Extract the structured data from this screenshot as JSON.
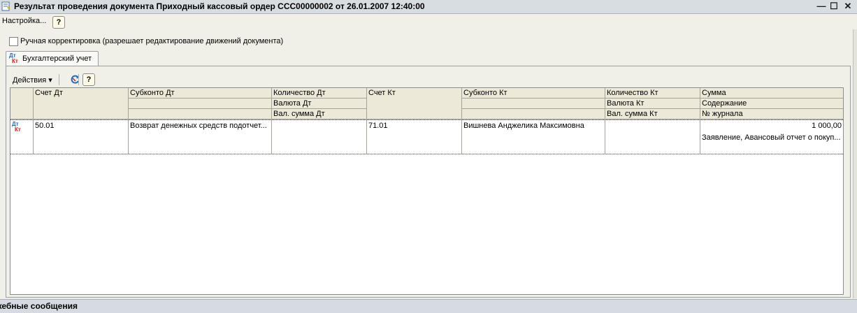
{
  "window": {
    "title": "Результат проведения документа Приходный кассовый ордер ССС00000002 от 26.01.2007 12:40:00",
    "minimize_glyph": "—",
    "maximize_glyph": "☐",
    "close_glyph": "✕"
  },
  "menu": {
    "settings": "Настройка...",
    "help": "?"
  },
  "manual_edit": {
    "label": "Ручная корректировка (разрешает редактирование движений документа)",
    "checked": false
  },
  "tabs": [
    {
      "label": "Бухгалтерский учет",
      "icon_top": "Дт",
      "icon_bottom": "Кт"
    }
  ],
  "toolbar": {
    "actions": "Действия ▾",
    "help": "?"
  },
  "grid": {
    "headers": {
      "schet_dt": "Счет Дт",
      "subkonto_dt": "Субконто Дт",
      "kolichestvo_dt": "Количество Дт",
      "valyuta_dt": "Валюта Дт",
      "val_summa_dt": "Вал. сумма Дт",
      "schet_kt": "Счет Кт",
      "subkonto_kt": "Субконто Кт",
      "kolichestvo_kt": "Количество Кт",
      "valyuta_kt": "Валюта Кт",
      "val_summa_kt": "Вал. сумма Кт",
      "summa": "Сумма",
      "soderzhanie": "Содержание",
      "nomer_zhurnala": "№ журнала"
    },
    "rows": [
      {
        "icon_top": "Дт",
        "icon_bottom": "Кт",
        "schet_dt": "50.01",
        "subkonto_dt": "Возврат денежных средств подотчет...",
        "schet_kt": "71.01",
        "subkonto_kt": "Вишнева Анджелика Максимовна",
        "summa": "1 000,00",
        "soderzhanie": "Заявление, Авансовый отчет о покуп..."
      }
    ]
  },
  "status_bar": {
    "label": "жебные сообщения"
  },
  "colors": {
    "dt_icon": "#1a6fc9",
    "kt_icon": "#c81e1e"
  }
}
